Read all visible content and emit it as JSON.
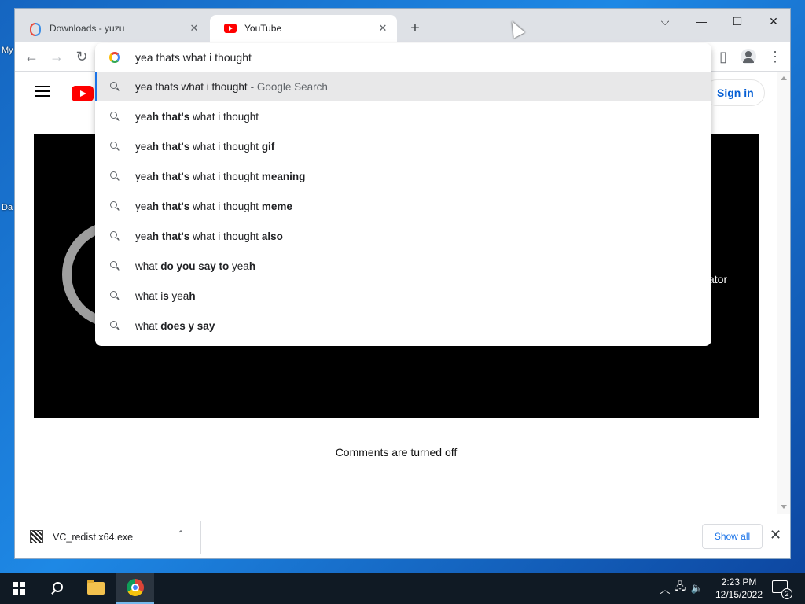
{
  "desktop": {
    "labels": [
      "My",
      "Da"
    ]
  },
  "browser": {
    "tabs": [
      {
        "title": "Downloads - yuzu",
        "icon": "yuzu-icon",
        "active": false
      },
      {
        "title": "YouTube",
        "icon": "youtube-icon",
        "active": true
      }
    ],
    "window_controls": {
      "tab_search": "⌵",
      "minimize": "—",
      "maximize": "☐",
      "close": "✕"
    },
    "toolbar": {
      "back": "←",
      "forward": "→",
      "reload": "↻",
      "side_panel": "▯",
      "menu": "⋮"
    },
    "omnibox": {
      "input_value": "yea thats what i thought",
      "suggestions": [
        {
          "parts": [
            {
              "t": "yea thats what i thought",
              "b": false
            }
          ],
          "suffix": "- Google Search",
          "selected": true
        },
        {
          "parts": [
            {
              "t": "yea",
              "b": false
            },
            {
              "t": "h that's",
              "b": true
            },
            {
              "t": " what i thought",
              "b": false
            }
          ],
          "suffix": "",
          "selected": false
        },
        {
          "parts": [
            {
              "t": "yea",
              "b": false
            },
            {
              "t": "h that's",
              "b": true
            },
            {
              "t": " what i thought ",
              "b": false
            },
            {
              "t": "gif",
              "b": true
            }
          ],
          "suffix": "",
          "selected": false
        },
        {
          "parts": [
            {
              "t": "yea",
              "b": false
            },
            {
              "t": "h that's",
              "b": true
            },
            {
              "t": " what i thought ",
              "b": false
            },
            {
              "t": "meaning",
              "b": true
            }
          ],
          "suffix": "",
          "selected": false
        },
        {
          "parts": [
            {
              "t": "yea",
              "b": false
            },
            {
              "t": "h that's",
              "b": true
            },
            {
              "t": " what i thought ",
              "b": false
            },
            {
              "t": "meme",
              "b": true
            }
          ],
          "suffix": "",
          "selected": false
        },
        {
          "parts": [
            {
              "t": "yea",
              "b": false
            },
            {
              "t": "h that's",
              "b": true
            },
            {
              "t": " what i thought ",
              "b": false
            },
            {
              "t": "also",
              "b": true
            }
          ],
          "suffix": "",
          "selected": false
        },
        {
          "parts": [
            {
              "t": "what ",
              "b": false
            },
            {
              "t": "do you say to",
              "b": true
            },
            {
              "t": " yea",
              "b": false
            },
            {
              "t": "h",
              "b": true
            }
          ],
          "suffix": "",
          "selected": false
        },
        {
          "parts": [
            {
              "t": "what i",
              "b": false
            },
            {
              "t": "s",
              "b": true
            },
            {
              "t": " yea",
              "b": false
            },
            {
              "t": "h",
              "b": true
            }
          ],
          "suffix": "",
          "selected": false
        },
        {
          "parts": [
            {
              "t": "what ",
              "b": false
            },
            {
              "t": "does y say",
              "b": true
            }
          ],
          "suffix": "",
          "selected": false
        }
      ]
    }
  },
  "youtube": {
    "sign_in": "Sign in",
    "player_partial_text": "ator",
    "comments_status": "Comments are turned off"
  },
  "downloads": {
    "file_name": "VC_redist.x64.exe",
    "chevron": "⌃",
    "show_all": "Show all",
    "close": "✕"
  },
  "taskbar": {
    "time": "2:23 PM",
    "date": "12/15/2022",
    "notification_count": "2",
    "tray_icons": [
      "chevron-up-icon",
      "network-icon",
      "volume-icon"
    ]
  }
}
